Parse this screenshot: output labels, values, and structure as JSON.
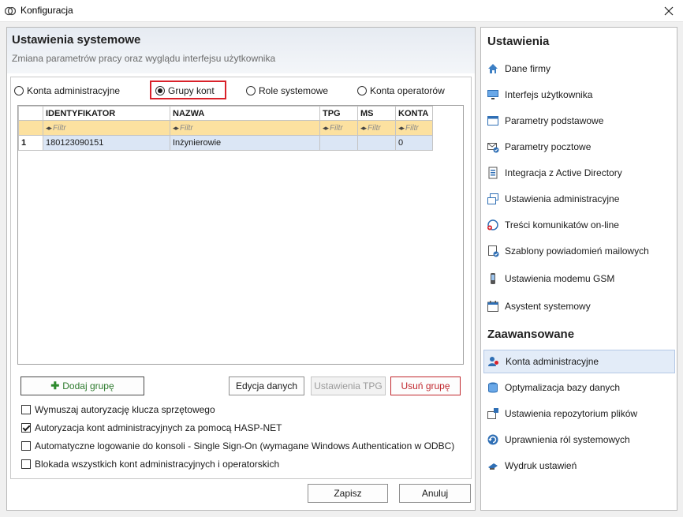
{
  "window": {
    "title": "Konfiguracja"
  },
  "main": {
    "title": "Ustawienia systemowe",
    "subtitle": "Zmiana parametrów pracy oraz wyglądu interfejsu użytkownika"
  },
  "radios": [
    {
      "label": "Konta administracyjne",
      "selected": false
    },
    {
      "label": "Grupy kont",
      "selected": true
    },
    {
      "label": "Role systemowe",
      "selected": false
    },
    {
      "label": "Konta operatorów",
      "selected": false
    }
  ],
  "grid": {
    "columns": [
      "IDENTYFIKATOR",
      "NAZWA",
      "TPG",
      "MS",
      "KONTA"
    ],
    "filter_placeholder": "Filtr",
    "rows": [
      {
        "num": "1",
        "id": "180123090151",
        "name": "Inżynierowie",
        "tpg": "",
        "ms": "",
        "konta": "0"
      }
    ]
  },
  "buttons": {
    "add_group": "Dodaj grupę",
    "edit_data": "Edycja danych",
    "tpg_settings": "Ustawienia TPG",
    "delete_group": "Usuń grupę",
    "save": "Zapisz",
    "cancel": "Anuluj"
  },
  "checkboxes": [
    {
      "label": "Wymuszaj autoryzację klucza sprzętowego",
      "checked": false
    },
    {
      "label": "Autoryzacja kont administracyjnych za pomocą HASP-NET",
      "checked": true
    },
    {
      "label": "Automatyczne logowanie do konsoli - Single Sign-On (wymagane Windows Authentication w ODBC)",
      "checked": false
    },
    {
      "label": "Blokada wszystkich kont administracyjnych i operatorskich",
      "checked": false
    }
  ],
  "sidebar": {
    "section1": "Ustawienia",
    "items1": [
      {
        "label": "Dane firmy",
        "icon": "house-icon"
      },
      {
        "label": "Interfejs użytkownika",
        "icon": "monitor-icon"
      },
      {
        "label": "Parametry podstawowe",
        "icon": "window-icon"
      },
      {
        "label": "Parametry pocztowe",
        "icon": "mail-check-icon"
      },
      {
        "label": "Integracja z Active Directory",
        "icon": "directory-icon"
      },
      {
        "label": "Ustawienia administracyjne",
        "icon": "windows-stack-icon"
      },
      {
        "label": "Treści komunikatów on-line",
        "icon": "message-plus-icon"
      },
      {
        "label": "Szablony powiadomień mailowych",
        "icon": "mail-template-icon"
      },
      {
        "label": "Ustawienia modemu GSM",
        "icon": "phone-icon"
      },
      {
        "label": "Asystent systemowy",
        "icon": "calendar-icon"
      }
    ],
    "section2": "Zaawansowane",
    "items2": [
      {
        "label": "Konta administracyjne",
        "icon": "users-icon",
        "active": true
      },
      {
        "label": "Optymalizacja bazy danych",
        "icon": "database-icon",
        "active": false
      },
      {
        "label": "Ustawienia repozytorium plików",
        "icon": "repository-icon",
        "active": false
      },
      {
        "label": "Uprawnienia ról systemowych",
        "icon": "refresh-icon",
        "active": false
      },
      {
        "label": "Wydruk ustawień",
        "icon": "print-icon",
        "active": false
      }
    ]
  },
  "colors": {
    "accent_highlight": "#d9212a",
    "filter_row": "#fce1a0",
    "selected_row": "#dbe6f5",
    "add_green": "#2d7a2d"
  }
}
